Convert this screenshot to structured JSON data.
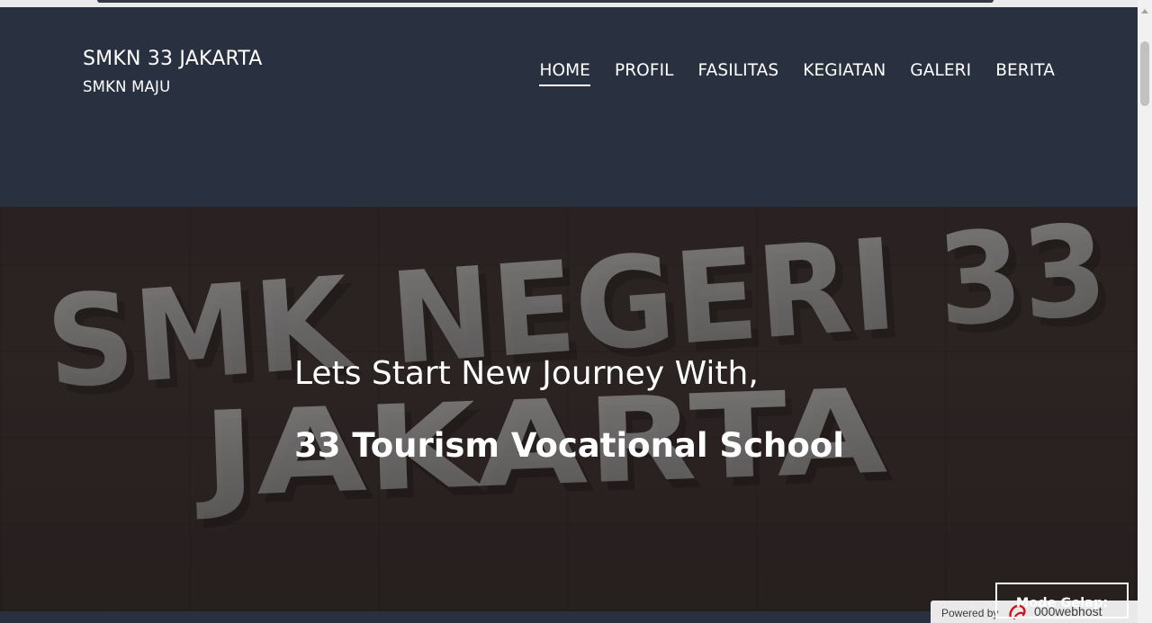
{
  "header": {
    "brand_title": "SMKN 33 JAKARTA",
    "brand_subtitle": "SMKN MAJU",
    "nav": [
      {
        "label": "HOME",
        "active": true
      },
      {
        "label": "PROFIL",
        "active": false
      },
      {
        "label": "FASILITAS",
        "active": false
      },
      {
        "label": "KEGIATAN",
        "active": false
      },
      {
        "label": "GALERI",
        "active": false
      },
      {
        "label": "BERITA",
        "active": false
      }
    ]
  },
  "hero": {
    "sign_line1": "SMK NEGERI 33",
    "sign_line2": "JAKARTA",
    "headline": "Lets Start New Journey With,",
    "subheadline": "33 Tourism Vocational School"
  },
  "dark_mode": {
    "label": "Mode Gelap: Aktif"
  },
  "badge": {
    "powered_by": "Powered by",
    "brand": "000webhost"
  },
  "colors": {
    "header_bg": "#29303f",
    "text": "#ffffff",
    "badge_bg": "#e9e9ea",
    "logo_accent": "#d0111b"
  }
}
